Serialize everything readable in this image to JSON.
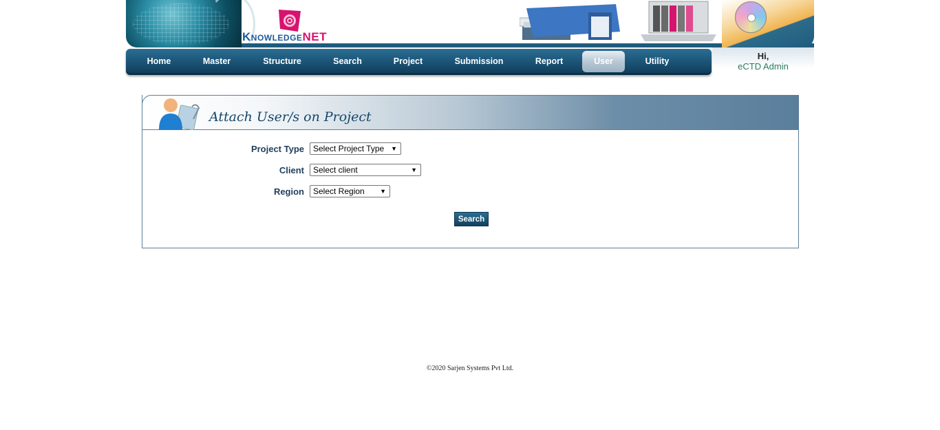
{
  "brand": {
    "name_part1": "Knowledge",
    "name_part2": "NET"
  },
  "nav": {
    "items": [
      {
        "label": "Home"
      },
      {
        "label": "Master"
      },
      {
        "label": "Structure"
      },
      {
        "label": "Search"
      },
      {
        "label": "Project"
      },
      {
        "label": "Submission"
      },
      {
        "label": "Report"
      },
      {
        "label": "User",
        "active": true
      },
      {
        "label": "Utility"
      }
    ]
  },
  "greeting": {
    "hi": "Hi,",
    "user": "eCTD Admin"
  },
  "panel": {
    "title": "Attach User/s on Project",
    "fields": {
      "project_type": {
        "label": "Project Type",
        "value": "Select Project Type"
      },
      "client": {
        "label": "Client",
        "value": "Select client"
      },
      "region": {
        "label": "Region",
        "value": "Select Region"
      }
    },
    "search_label": "Search"
  },
  "footer": {
    "text": "©2020 Sarjen Systems Pvt Ltd."
  },
  "colors": {
    "nav_blue": "#1d5679",
    "title_blue": "#15476a",
    "label_blue": "#1f3e5c",
    "brand_magenta": "#d6136e",
    "brand_blue": "#1c5a9a"
  }
}
